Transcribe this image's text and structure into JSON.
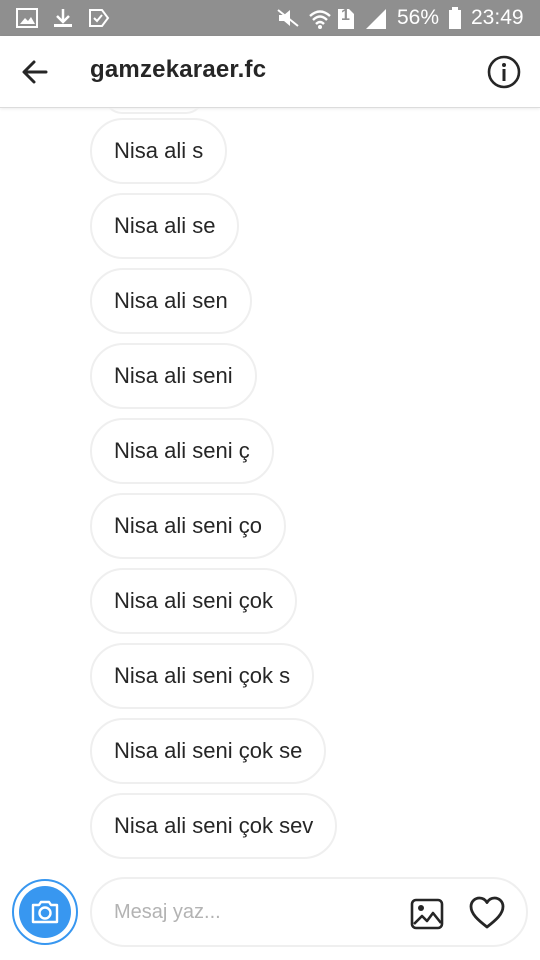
{
  "status_bar": {
    "battery": "56%",
    "time": "23:49",
    "sim_slot": "1",
    "icons": [
      "gallery-notification-icon",
      "download-icon",
      "check-notification-icon",
      "mute-icon",
      "wifi-icon",
      "sim-icon",
      "signal-icon",
      "battery-icon"
    ]
  },
  "header": {
    "title": "gamzekaraer.fc",
    "back_icon": "arrow-left-icon",
    "info_icon": "info-icon"
  },
  "messages": [
    {
      "text": "Nisa ali s"
    },
    {
      "text": "Nisa ali se"
    },
    {
      "text": "Nisa ali sen"
    },
    {
      "text": "Nisa ali seni"
    },
    {
      "text": "Nisa ali seni ç"
    },
    {
      "text": "Nisa ali seni ço"
    },
    {
      "text": "Nisa ali seni çok"
    },
    {
      "text": "Nisa ali seni çok s"
    },
    {
      "text": "Nisa ali seni çok se"
    },
    {
      "text": "Nisa ali seni çok sev"
    }
  ],
  "composer": {
    "placeholder": "Mesaj yaz...",
    "camera_icon": "camera-icon",
    "gallery_icon": "image-icon",
    "like_icon": "heart-icon"
  },
  "colors": {
    "accent": "#3897f0",
    "status_bar": "#8f8f8f",
    "bubble_border": "#efefef",
    "text": "#262626",
    "placeholder": "#b3b3b3"
  }
}
